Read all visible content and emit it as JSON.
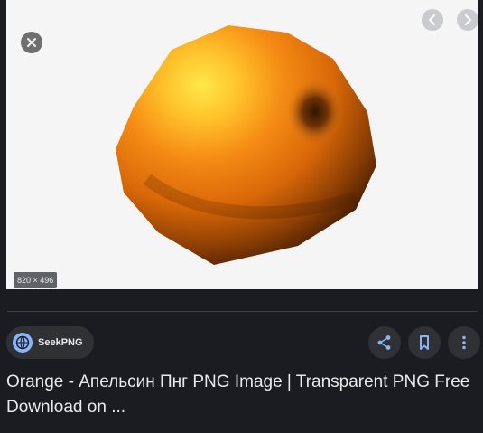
{
  "preview": {
    "dimensions": "820 × 496",
    "image_subject": "orange"
  },
  "source": {
    "name": "SeekPNG"
  },
  "title": "Orange - Апельсин Пнг PNG Image | Transparent PNG Free Download on ...",
  "icons": {
    "close": "close-icon",
    "prev": "chevron-left-icon",
    "next": "chevron-right-icon",
    "globe": "globe-icon",
    "share": "share-icon",
    "save": "bookmark-icon",
    "more": "more-vert-icon"
  },
  "colors": {
    "background": "#1a1c21",
    "accent": "#8ab4f8",
    "text": "#e8eaed",
    "button": "#303134"
  }
}
